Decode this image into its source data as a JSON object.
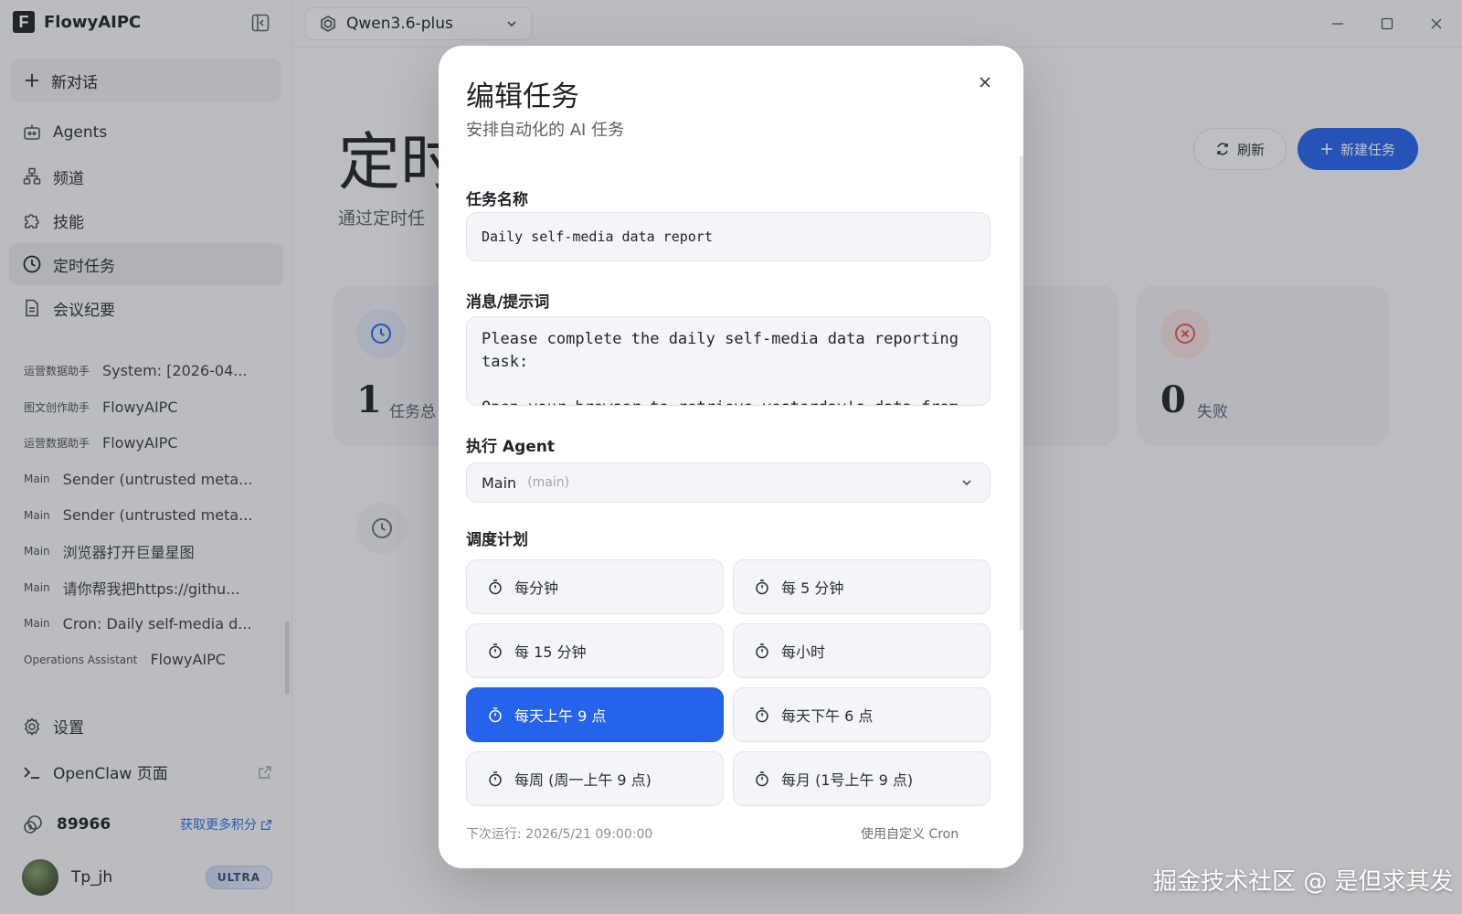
{
  "app": {
    "name": "FlowyAIPC",
    "logo_letter": "F"
  },
  "model_select": {
    "value": "Qwen3.6-plus"
  },
  "sidebar": {
    "new_chat": "新对话",
    "nav": [
      {
        "label": "Agents",
        "icon": "robot-icon"
      },
      {
        "label": "频道",
        "icon": "channels-icon"
      },
      {
        "label": "技能",
        "icon": "puzzle-icon"
      },
      {
        "label": "定时任务",
        "icon": "clock-icon",
        "active": true
      },
      {
        "label": "会议纪要",
        "icon": "document-icon"
      }
    ],
    "history": [
      {
        "tag": "运营数据助手",
        "title": "System: [2026-04..."
      },
      {
        "tag": "图文创作助手",
        "title": "FlowyAIPC"
      },
      {
        "tag": "运营数据助手",
        "title": "FlowyAIPC"
      },
      {
        "tag": "Main",
        "title": "Sender (untrusted meta..."
      },
      {
        "tag": "Main",
        "title": "Sender (untrusted meta..."
      },
      {
        "tag": "Main",
        "title": "浏览器打开巨量星图"
      },
      {
        "tag": "Main",
        "title": "请你帮我把https://githu..."
      },
      {
        "tag": "Main",
        "title": "Cron: Daily self-media d..."
      },
      {
        "tag": "Operations Assistant",
        "title": "FlowyAIPC"
      }
    ],
    "settings": "设置",
    "openclaw": "OpenClaw 页面",
    "credits": {
      "value": "89966",
      "link": "获取更多积分"
    },
    "user": {
      "name": "Tp_jh",
      "badge": "ULTRA"
    }
  },
  "main": {
    "title": "定时",
    "subtitle": "通过定时任",
    "refresh": "刷新",
    "new_task": "新建任务",
    "stats": [
      {
        "value": "1",
        "label": "任务总"
      },
      {
        "value": "0",
        "label": "失败"
      }
    ]
  },
  "modal": {
    "title": "编辑任务",
    "subtitle": "安排自动化的 AI 任务",
    "task_name_label": "任务名称",
    "task_name_value": "Daily self-media data report",
    "message_label": "消息/提示词",
    "message_value": "Please complete the daily self-media data reporting task:\n\nOpen your browser to retrieve yesterday's data from the",
    "agent_label": "执行 Agent",
    "agent_value": "Main",
    "agent_sub": "(main)",
    "schedule_label": "调度计划",
    "schedules": [
      {
        "label": "每分钟",
        "active": false
      },
      {
        "label": "每 5 分钟",
        "active": false
      },
      {
        "label": "每 15 分钟",
        "active": false
      },
      {
        "label": "每小时",
        "active": false
      },
      {
        "label": "每天上午 9 点",
        "active": true
      },
      {
        "label": "每天下午 6 点",
        "active": false
      },
      {
        "label": "每周 (周一上午 9 点)",
        "active": false
      },
      {
        "label": "每月 (1号上午 9 点)",
        "active": false
      }
    ],
    "next_run": "下次运行: 2026/5/21 09:00:00",
    "custom_cron": "使用自定义 Cron"
  },
  "watermark": "掘金技术社区 @ 是但求其发",
  "colors": {
    "accent": "#2563eb",
    "danger": "#e25555"
  }
}
